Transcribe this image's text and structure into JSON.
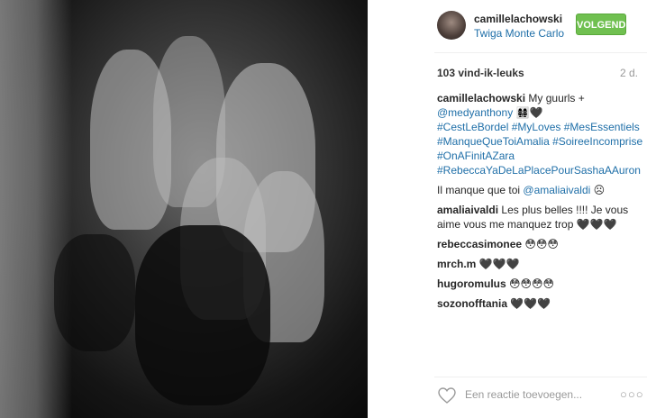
{
  "post": {
    "username": "camillelachowski",
    "location": "Twiga Monte Carlo",
    "follow_label": "VOLGEND",
    "likes": "103 vind-ik-leuks",
    "age": "2 d."
  },
  "caption": {
    "user": "camillelachowski",
    "text": "My guurls +",
    "mention": "@medyanthony",
    "emoji": "👩‍👩‍👧‍👧🖤",
    "tags": [
      "#CestLeBordel #MyLoves #MesEssentiels",
      "#ManqueQueToiAmalia #SoireeIncomprise",
      "#OnAFinitAZara",
      "#RebeccaYaDeLaPlacePourSashaAAuron"
    ],
    "extra_text": "Il manque que toi",
    "extra_mention": "@amaliaivaldi",
    "extra_emoji": "☹"
  },
  "comments": [
    {
      "user": "amaliaivaldi",
      "text": "Les plus belles !!!! Je vous aime vous me manquez trop 🖤🖤🖤"
    },
    {
      "user": "rebeccasimonee",
      "text": "😳😳😳"
    },
    {
      "user": "mrch.m",
      "text": "🖤🖤🖤"
    },
    {
      "user": "hugoromulus",
      "text": "😳😳😳😳"
    },
    {
      "user": "sozonofftania",
      "text": "🖤🖤🖤"
    }
  ],
  "footer": {
    "placeholder": "Een reactie toevoegen...",
    "more": "○○○"
  }
}
